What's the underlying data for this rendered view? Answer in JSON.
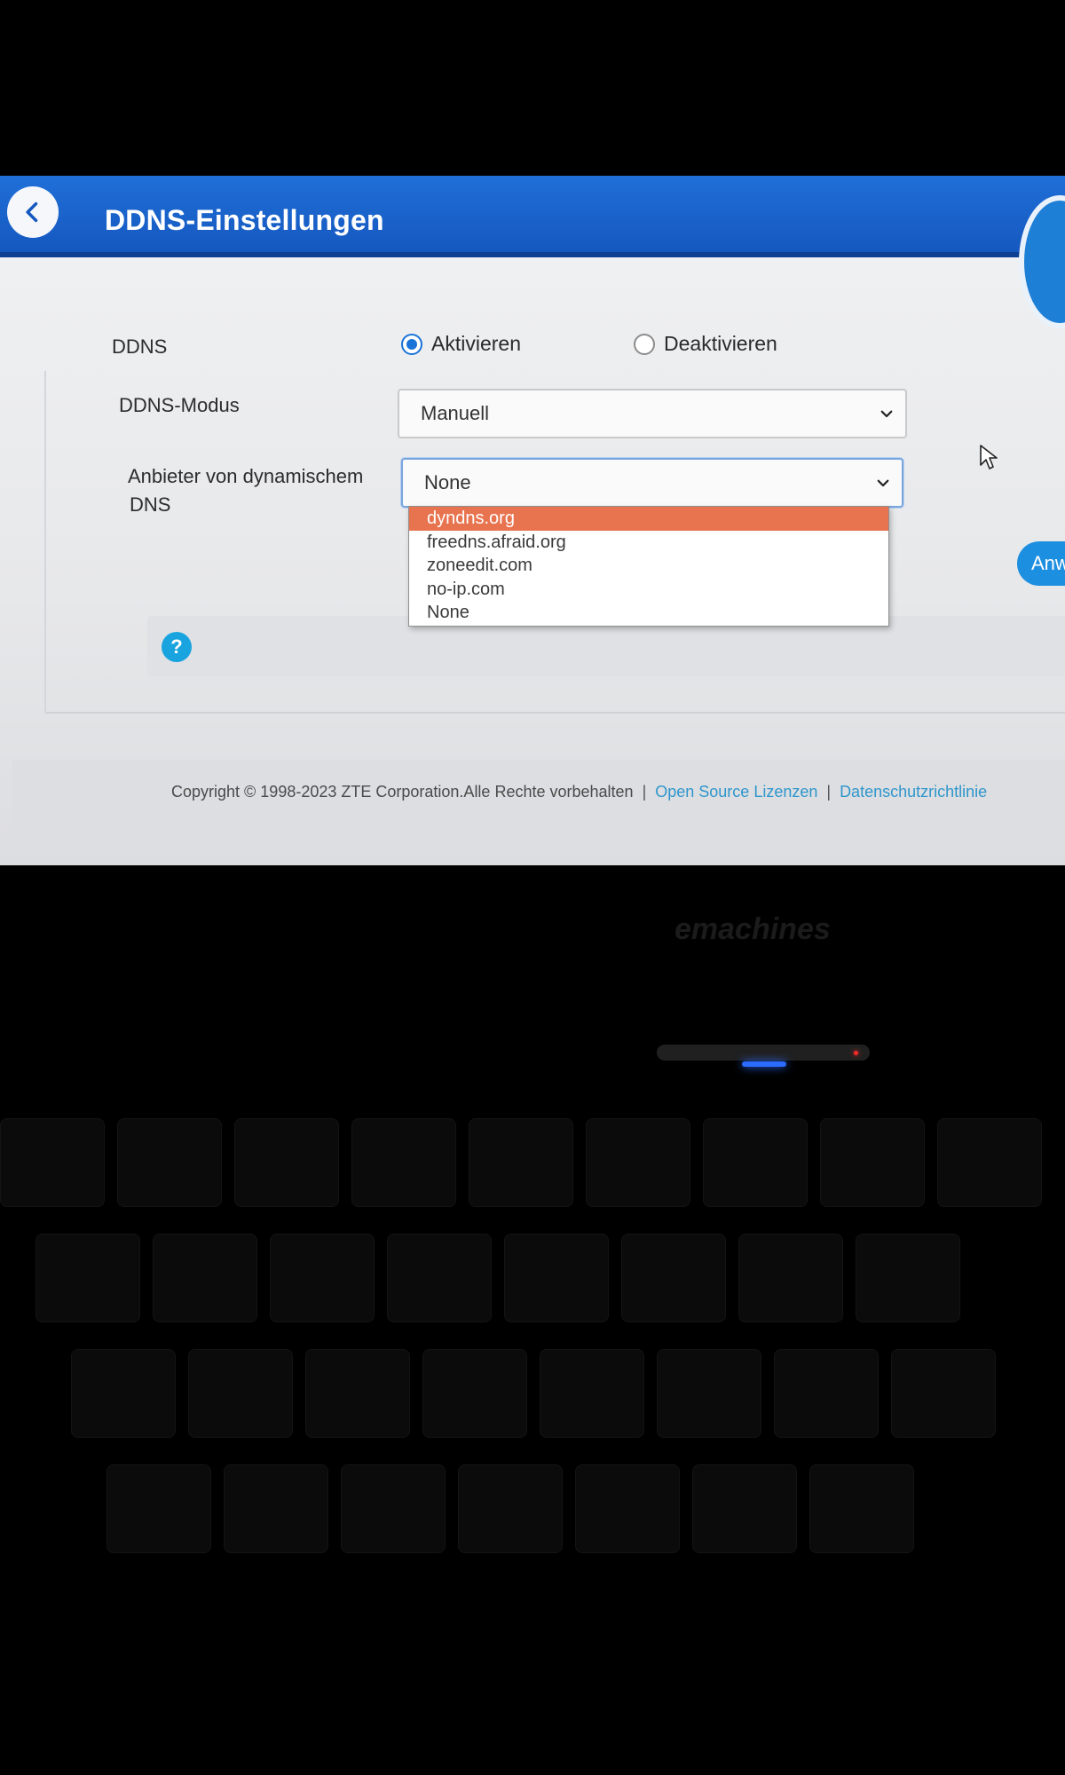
{
  "header": {
    "title": "DDNS-Einstellungen"
  },
  "form": {
    "ddns_label": "DDNS",
    "ddns_options": [
      {
        "label": "Aktivieren",
        "checked": true
      },
      {
        "label": "Deaktivieren",
        "checked": false
      }
    ],
    "mode_label": "DDNS-Modus",
    "mode_value": "Manuell",
    "provider_label_line1": "Anbieter von dynamischem",
    "provider_label_line2": "DNS",
    "provider_value": "None",
    "provider_options": [
      "dyndns.org",
      "freedns.afraid.org",
      "zoneedit.com",
      "no-ip.com",
      "None"
    ],
    "provider_highlighted": "dyndns.org",
    "apply_label": "Anw"
  },
  "help": {
    "icon": "?"
  },
  "footer": {
    "copyright": "Copyright © 1998-2023 ZTE Corporation.Alle Rechte vorbehalten",
    "sep1": "|",
    "open_source": "Open Source Lizenzen",
    "sep2": "|",
    "privacy": "Datenschutzrichtlinie"
  },
  "laptop": {
    "brand": "emachines"
  },
  "colors": {
    "header_blue": "#1f6fd8",
    "highlight": "#e8734f",
    "link": "#2f96cc",
    "radio_active": "#1a73d9"
  }
}
